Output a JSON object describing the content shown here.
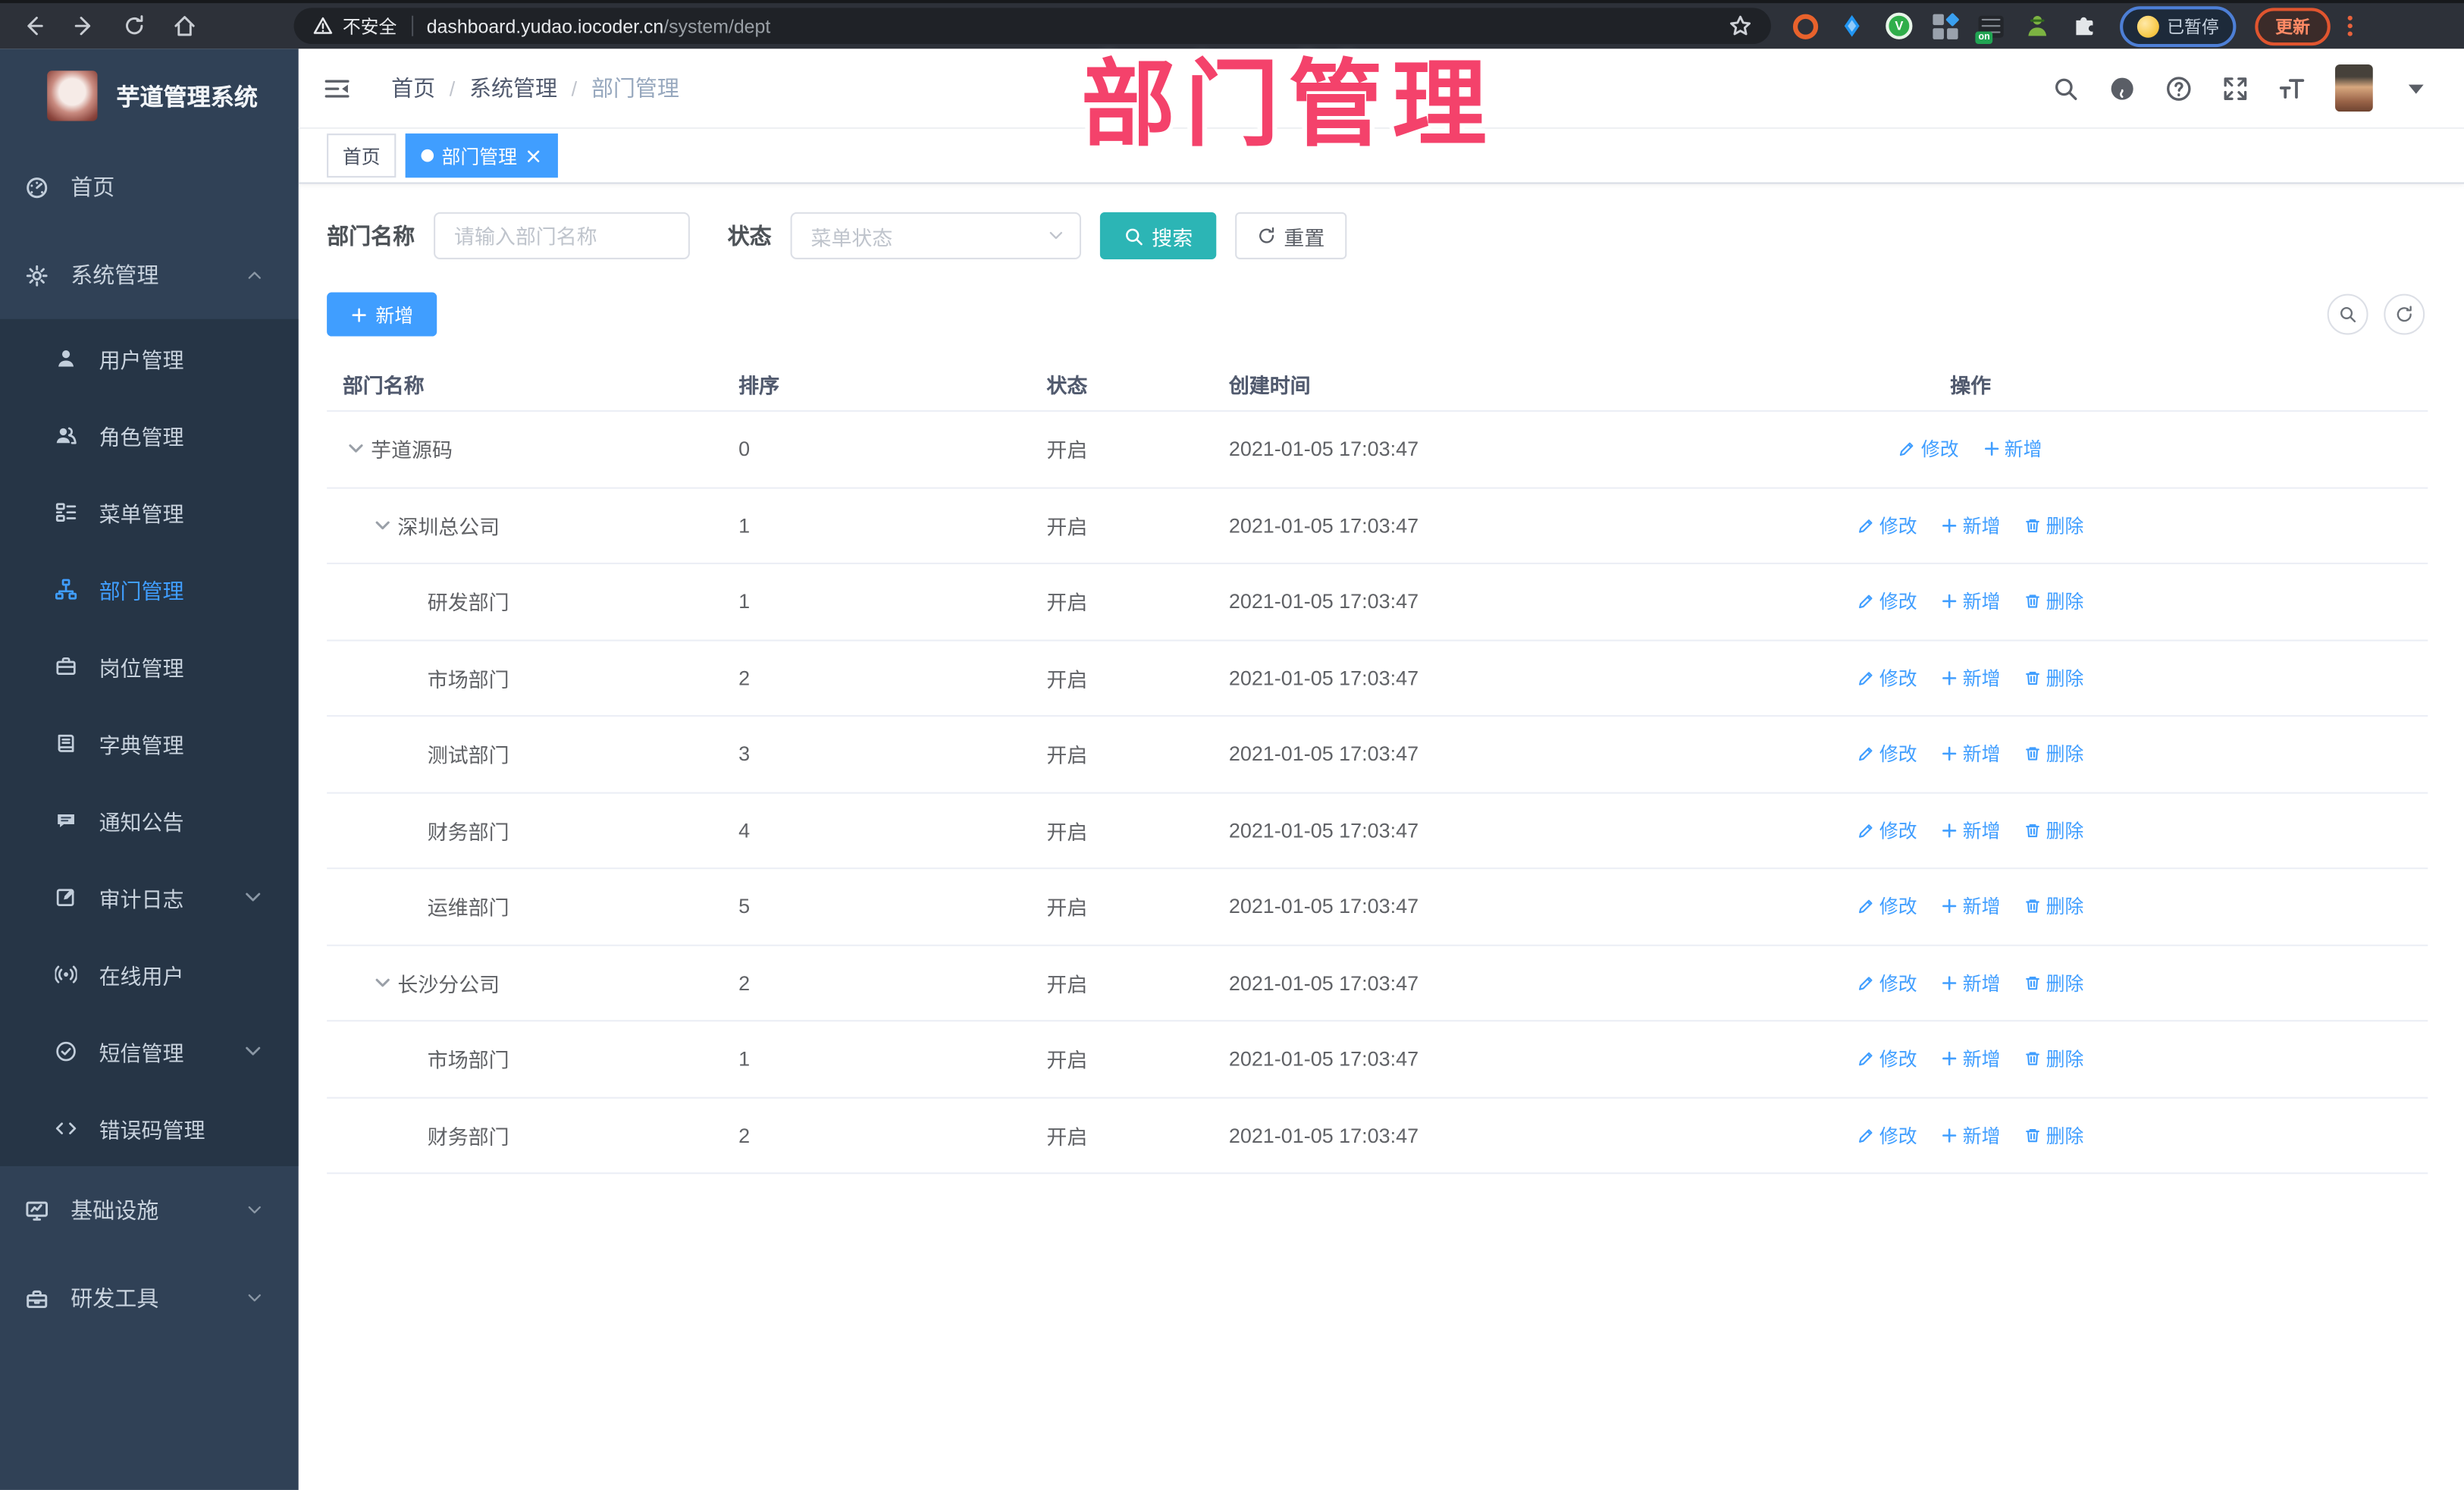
{
  "browser": {
    "nav_icons": [
      "back-icon",
      "forward-icon",
      "reload-icon",
      "home-icon"
    ],
    "security_label": "不安全",
    "url_host": "dashboard.yudao.iocoder.cn",
    "url_path": "/system/dept",
    "extension_icons": [
      "target-ext-icon",
      "drop-ext-icon",
      "green-check-ext-icon",
      "grid-ext-icon",
      "list-on-ext-icon",
      "spy-ext-icon",
      "puzzle-ext-icon"
    ],
    "list_ext_badge": "on",
    "green_check_letter": "V",
    "paused_label": "已暂停",
    "update_label": "更新"
  },
  "watermark": {
    "text": "部门管理",
    "color": "#f4426b"
  },
  "sidebar": {
    "title": "芋道管理系统",
    "items": [
      {
        "icon": "dashboard-icon",
        "label": "首页",
        "type": "top"
      },
      {
        "icon": "gear-icon",
        "label": "系统管理",
        "type": "top",
        "chevron": "up"
      },
      {
        "icon": "user-icon",
        "label": "用户管理",
        "type": "sub"
      },
      {
        "icon": "users-icon",
        "label": "角色管理",
        "type": "sub"
      },
      {
        "icon": "menu-list-icon",
        "label": "菜单管理",
        "type": "sub"
      },
      {
        "icon": "org-tree-icon",
        "label": "部门管理",
        "type": "sub",
        "active": true
      },
      {
        "icon": "briefcase-icon",
        "label": "岗位管理",
        "type": "sub"
      },
      {
        "icon": "book-icon",
        "label": "字典管理",
        "type": "sub"
      },
      {
        "icon": "chat-icon",
        "label": "通知公告",
        "type": "sub"
      },
      {
        "icon": "edit-log-icon",
        "label": "审计日志",
        "type": "sub",
        "chevron": "down"
      },
      {
        "icon": "broadcast-icon",
        "label": "在线用户",
        "type": "sub"
      },
      {
        "icon": "shield-check-icon",
        "label": "短信管理",
        "type": "sub",
        "chevron": "down"
      },
      {
        "icon": "code-icon",
        "label": "错误码管理",
        "type": "sub"
      },
      {
        "icon": "monitor-icon",
        "label": "基础设施",
        "type": "top",
        "chevron": "down"
      },
      {
        "icon": "toolbox-icon",
        "label": "研发工具",
        "type": "top",
        "chevron": "down"
      }
    ]
  },
  "header": {
    "breadcrumb": [
      {
        "label": "首页",
        "current": false
      },
      {
        "label": "系统管理",
        "current": false
      },
      {
        "label": "部门管理",
        "current": true
      }
    ],
    "separator": "/",
    "icons": [
      "search-icon",
      "github-icon",
      "question-icon",
      "fullscreen-icon",
      "fontsize-icon"
    ]
  },
  "tabs": [
    {
      "label": "首页",
      "active": false,
      "closable": false
    },
    {
      "label": "部门管理",
      "active": true,
      "closable": true
    }
  ],
  "filters": {
    "dept_label": "部门名称",
    "dept_placeholder": "请输入部门名称",
    "status_label": "状态",
    "status_placeholder": "菜单状态",
    "search_label": "搜索",
    "reset_label": "重置"
  },
  "toolbar": {
    "add_label": "新增"
  },
  "table": {
    "columns": [
      "部门名称",
      "排序",
      "状态",
      "创建时间",
      "操作"
    ],
    "action_labels": {
      "edit": "修改",
      "add": "新增",
      "delete": "删除"
    },
    "rows": [
      {
        "name": "芋道源码",
        "level": 0,
        "expandable": true,
        "sort": "0",
        "status": "开启",
        "created": "2021-01-05 17:03:47",
        "actions": [
          "edit",
          "add"
        ]
      },
      {
        "name": "深圳总公司",
        "level": 1,
        "expandable": true,
        "sort": "1",
        "status": "开启",
        "created": "2021-01-05 17:03:47",
        "actions": [
          "edit",
          "add",
          "delete"
        ]
      },
      {
        "name": "研发部门",
        "level": 2,
        "expandable": false,
        "sort": "1",
        "status": "开启",
        "created": "2021-01-05 17:03:47",
        "actions": [
          "edit",
          "add",
          "delete"
        ]
      },
      {
        "name": "市场部门",
        "level": 2,
        "expandable": false,
        "sort": "2",
        "status": "开启",
        "created": "2021-01-05 17:03:47",
        "actions": [
          "edit",
          "add",
          "delete"
        ]
      },
      {
        "name": "测试部门",
        "level": 2,
        "expandable": false,
        "sort": "3",
        "status": "开启",
        "created": "2021-01-05 17:03:47",
        "actions": [
          "edit",
          "add",
          "delete"
        ]
      },
      {
        "name": "财务部门",
        "level": 2,
        "expandable": false,
        "sort": "4",
        "status": "开启",
        "created": "2021-01-05 17:03:47",
        "actions": [
          "edit",
          "add",
          "delete"
        ]
      },
      {
        "name": "运维部门",
        "level": 2,
        "expandable": false,
        "sort": "5",
        "status": "开启",
        "created": "2021-01-05 17:03:47",
        "actions": [
          "edit",
          "add",
          "delete"
        ]
      },
      {
        "name": "长沙分公司",
        "level": 1,
        "expandable": true,
        "sort": "2",
        "status": "开启",
        "created": "2021-01-05 17:03:47",
        "actions": [
          "edit",
          "add",
          "delete"
        ]
      },
      {
        "name": "市场部门",
        "level": 2,
        "expandable": false,
        "sort": "1",
        "status": "开启",
        "created": "2021-01-05 17:03:47",
        "actions": [
          "edit",
          "add",
          "delete"
        ]
      },
      {
        "name": "财务部门",
        "level": 2,
        "expandable": false,
        "sort": "2",
        "status": "开启",
        "created": "2021-01-05 17:03:47",
        "actions": [
          "edit",
          "add",
          "delete"
        ]
      }
    ]
  }
}
